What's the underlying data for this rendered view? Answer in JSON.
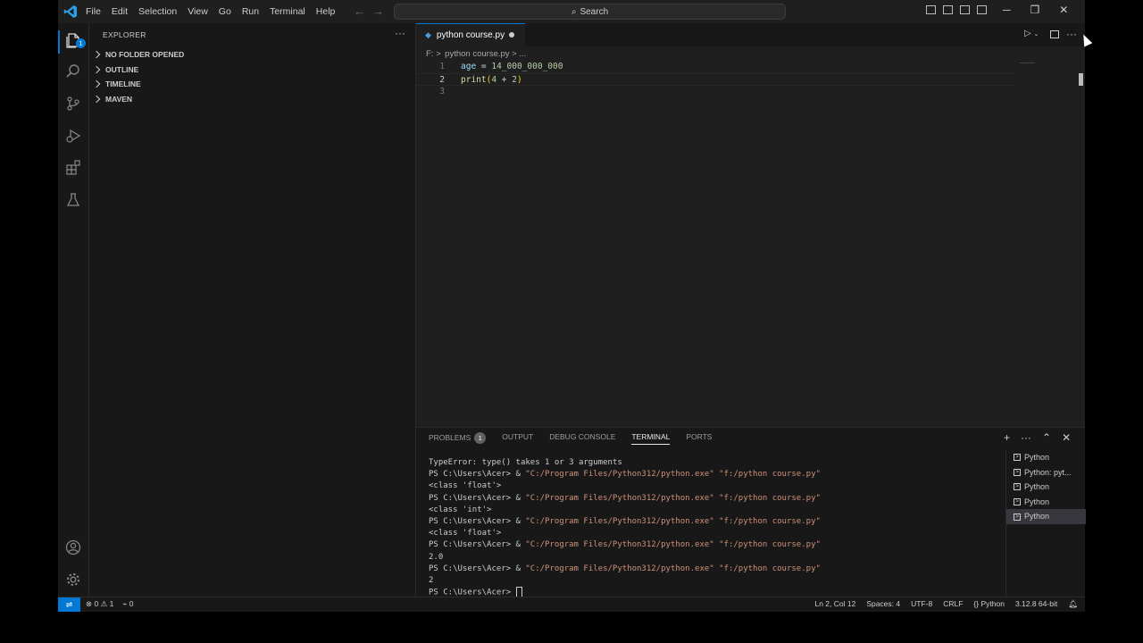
{
  "menu": [
    "File",
    "Edit",
    "Selection",
    "View",
    "Go",
    "Run",
    "Terminal",
    "Help"
  ],
  "search": {
    "label": "Search"
  },
  "activity": {
    "explorer_badge": "1"
  },
  "sidebar": {
    "title": "EXPLORER",
    "sections": [
      "NO FOLDER OPENED",
      "OUTLINE",
      "TIMELINE",
      "MAVEN"
    ]
  },
  "editor": {
    "tab_label": "python course.py",
    "breadcrumb": "F: >  python course.py > ...",
    "lines": [
      {
        "n": "1",
        "code": "age = 14_000_000_000"
      },
      {
        "n": "2",
        "code": "print(4 + 2)"
      },
      {
        "n": "3",
        "code": ""
      }
    ]
  },
  "panel": {
    "tabs": [
      "PROBLEMS",
      "OUTPUT",
      "DEBUG CONSOLE",
      "TERMINAL",
      "PORTS"
    ],
    "problems_count": "1",
    "active_tab": "TERMINAL",
    "terminal_lines": [
      "TypeError: type() takes 1 or 3 arguments",
      "PS C:\\Users\\Acer> & \"C:/Program Files/Python312/python.exe\" \"f:/python course.py\"",
      "<class 'float'>",
      "PS C:\\Users\\Acer> & \"C:/Program Files/Python312/python.exe\" \"f:/python course.py\"",
      "<class 'int'>",
      "PS C:\\Users\\Acer> & \"C:/Program Files/Python312/python.exe\" \"f:/python course.py\"",
      "<class 'float'>",
      "PS C:\\Users\\Acer> & \"C:/Program Files/Python312/python.exe\" \"f:/python course.py\"",
      "2.0",
      "PS C:\\Users\\Acer> & \"C:/Program Files/Python312/python.exe\" \"f:/python course.py\"",
      "2",
      "PS C:\\Users\\Acer> "
    ],
    "terminals": [
      "Python",
      "Python: pyt...",
      "Python",
      "Python",
      "Python"
    ],
    "selected_terminal_index": 4
  },
  "status": {
    "errors": "0",
    "warnings": "1",
    "ports": "0",
    "position": "Ln 2, Col 12",
    "spaces": "Spaces: 4",
    "encoding": "UTF-8",
    "eol": "CRLF",
    "language": "Python",
    "interpreter": "3.12.8 64-bit"
  }
}
